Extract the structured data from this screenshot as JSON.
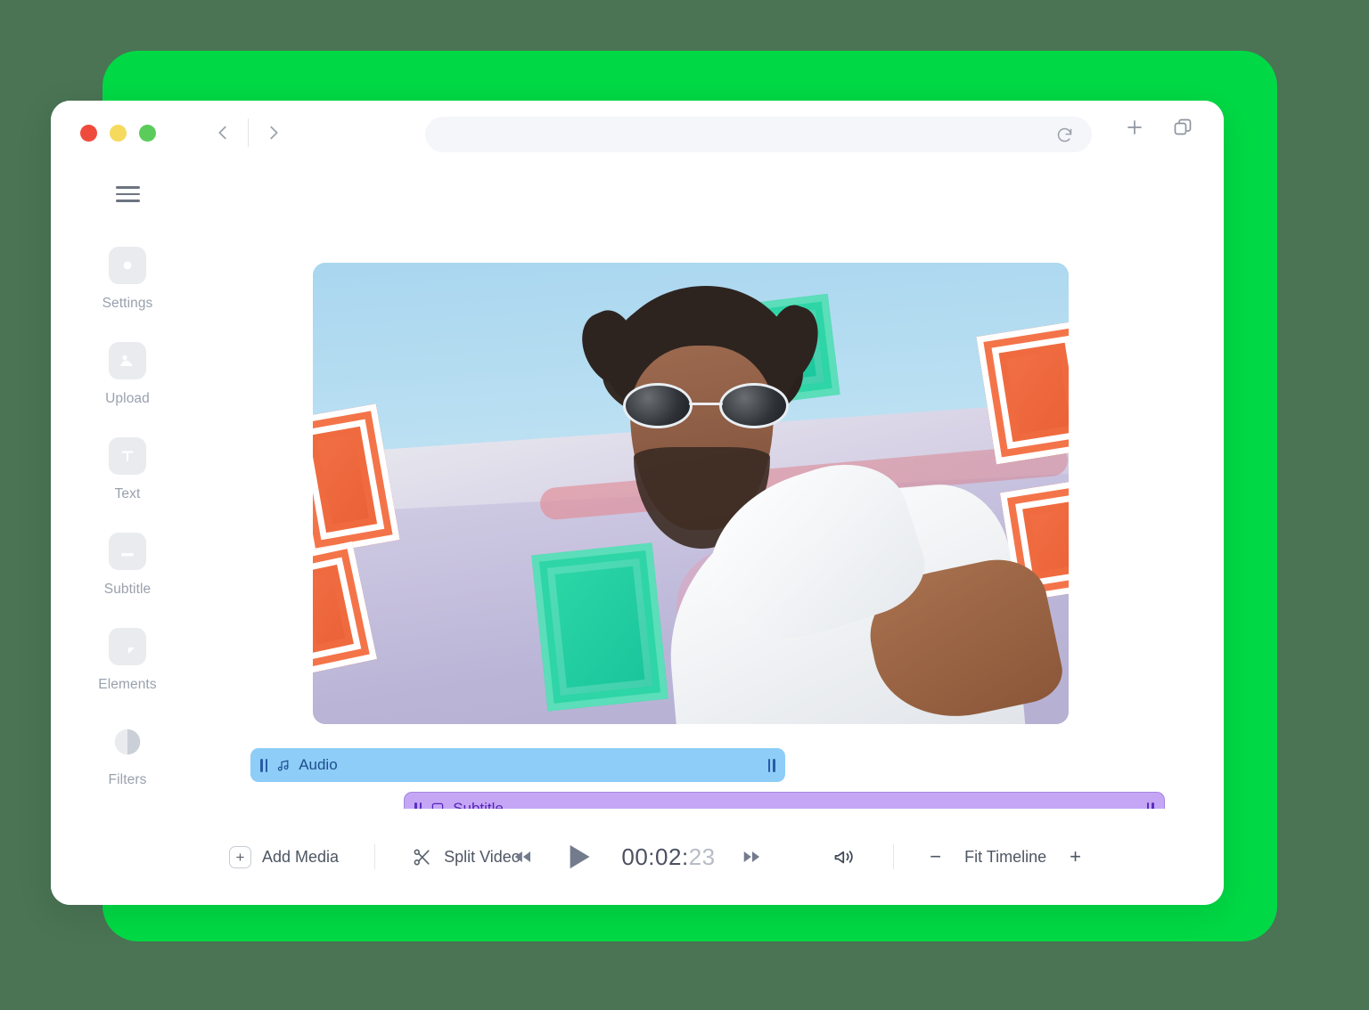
{
  "theme": {
    "page_background": "#4a7454",
    "accent_card": "#00d945",
    "window_background": "#ffffff",
    "audio_track_color": "#8dcdf7",
    "audio_track_text": "#1f4d8f",
    "subtitle_track_color": "#c4a6f5",
    "subtitle_track_text": "#5424b8"
  },
  "browser": {
    "traffic_lights": [
      {
        "name": "close",
        "color": "#ef4b3c"
      },
      {
        "name": "minimize",
        "color": "#f6da5e"
      },
      {
        "name": "maximize",
        "color": "#5bcc5b"
      }
    ],
    "back_icon": "chevron-left-icon",
    "forward_icon": "chevron-right-icon",
    "address_bar": {
      "value": "",
      "placeholder": ""
    },
    "reload_icon": "reload-icon",
    "new_tab_icon": "plus-icon",
    "tabs_icon": "copy-tabs-icon"
  },
  "sidebar": {
    "menu_icon": "hamburger-menu-icon",
    "items": [
      {
        "label": "Settings",
        "icon": "settings-circle-icon"
      },
      {
        "label": "Upload",
        "icon": "image-upload-icon"
      },
      {
        "label": "Text",
        "icon": "text-t-icon"
      },
      {
        "label": "Subtitle",
        "icon": "subtitle-icon"
      },
      {
        "label": "Elements",
        "icon": "elements-shape-icon"
      },
      {
        "label": "Filters",
        "icon": "filters-contrast-icon"
      }
    ]
  },
  "preview": {
    "alt": "Man with dreadlocks and round sunglasses in white t-shirt in front of colorful geometric mural"
  },
  "timeline": {
    "tracks": [
      {
        "id": "audio",
        "label": "Audio",
        "icon": "music-note-icon",
        "left_handle": "drag-handle",
        "right_handle": "drag-handle"
      },
      {
        "id": "subtitle",
        "label": "Subtitle",
        "icon": "subtitle-box-icon",
        "left_handle": "drag-handle",
        "right_handle": "drag-handle"
      }
    ],
    "clips": [
      {
        "id": "clip-1",
        "handle_side": "right"
      },
      {
        "id": "clip-2",
        "handle_side": "left"
      }
    ]
  },
  "toolbar": {
    "add_media_label": "Add Media",
    "add_media_icon": "plus-box-icon",
    "split_video_label": "Split Video",
    "split_video_icon": "scissors-icon",
    "rewind_icon": "rewind-icon",
    "play_icon": "play-icon",
    "forward_icon": "fast-forward-icon",
    "timecode": {
      "main": "00:02:",
      "frames": "23",
      "full": "00:02:23"
    },
    "volume_icon": "volume-icon",
    "zoom_out_label": "−",
    "zoom_label": "Fit Timeline",
    "zoom_in_label": "+"
  }
}
